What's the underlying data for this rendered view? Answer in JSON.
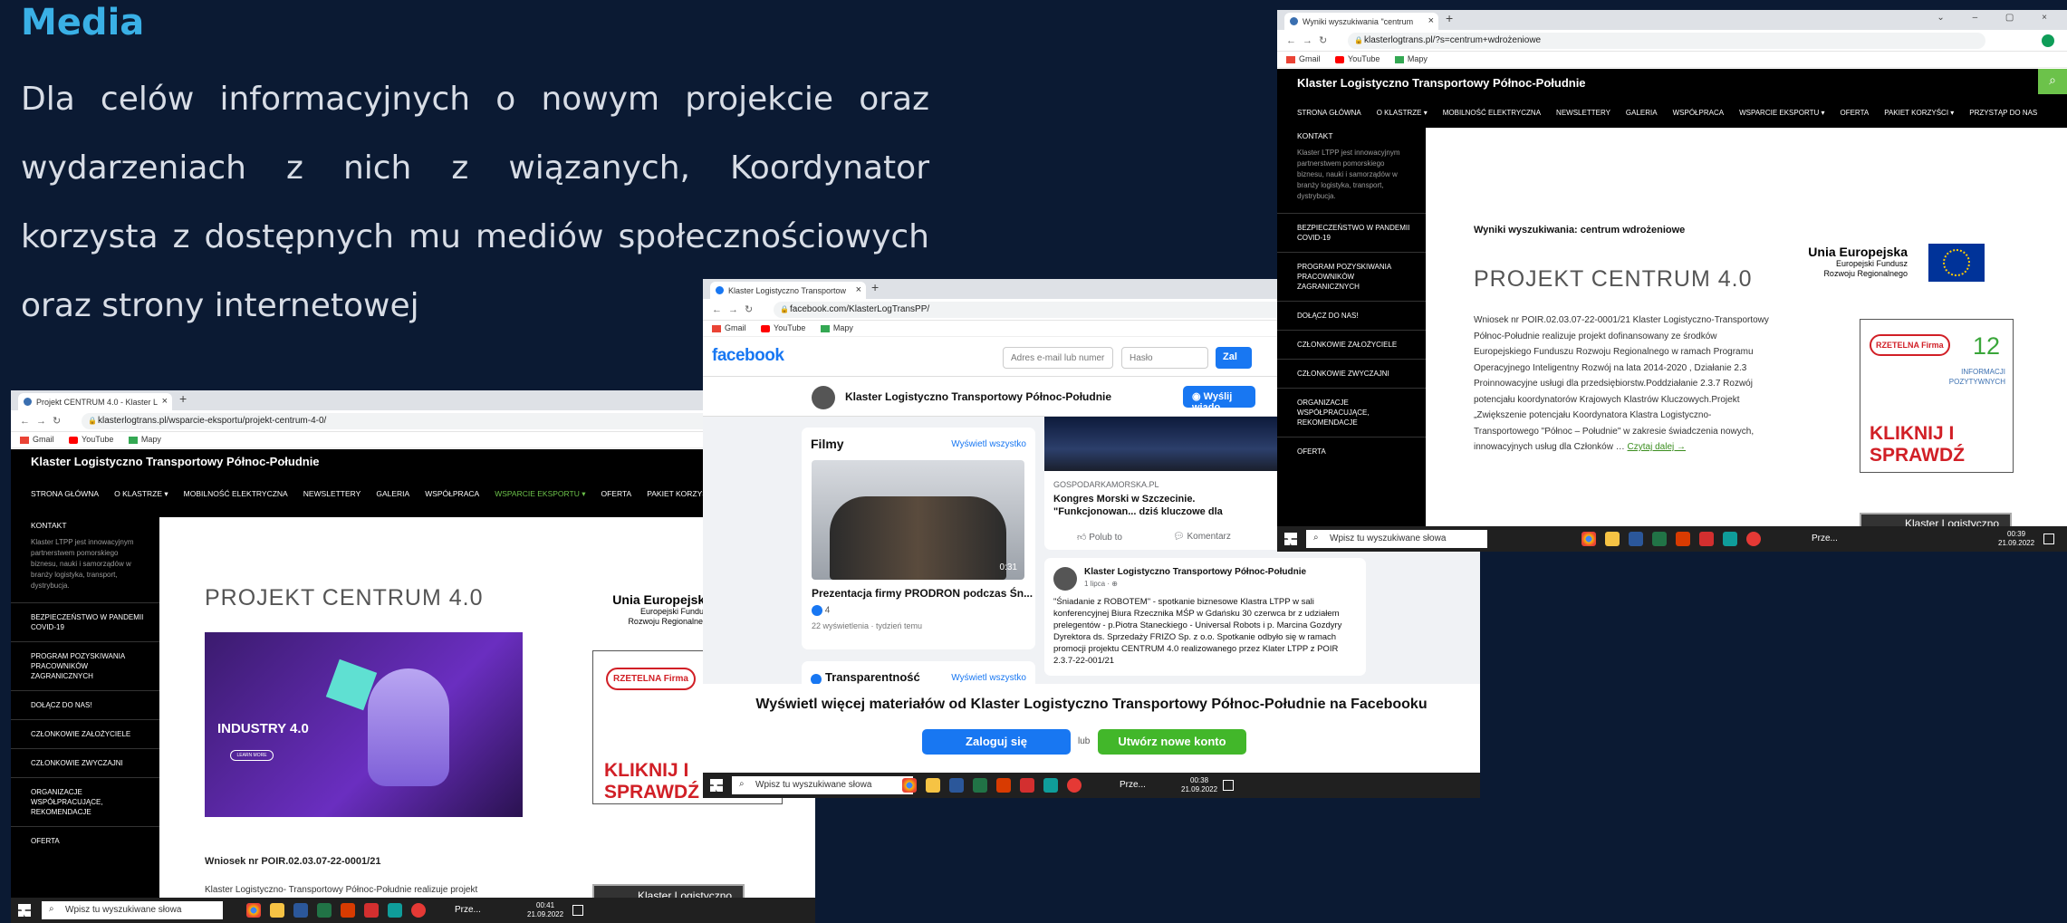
{
  "slide": {
    "title": "Media",
    "body": "Dla celów informacyjnych o nowym projekcie oraz wydarzeniach z nich z wiązanych, Koordynator korzysta z dostępnych mu mediów społecznościowych oraz strony internetowej"
  },
  "colors": {
    "slide_bg": "#0b1a33",
    "title": "#3ab0e6",
    "fb_blue": "#1877f2",
    "fb_green": "#42b72a",
    "rzetelna_red": "#d11f26",
    "ue_blue": "#003399"
  },
  "bookmarks": [
    "Gmail",
    "YouTube",
    "Mapy"
  ],
  "taskbar": {
    "search_placeholder": "Wpisz tu wyszukiwane słowa",
    "weather": "Prze..."
  },
  "shot1": {
    "tab_title": "Projekt CENTRUM 4.0 - Klaster L",
    "url": "klasterlogtrans.pl/wsparcie-eksportu/projekt-centrum-4-0/",
    "site_name": "Klaster Logistyczno Transportowy Północ-Południe",
    "menu": [
      "STRONA GŁÓWNA",
      "O KLASTRZE ▾",
      "MOBILNOŚĆ ELEKTRYCZNA",
      "NEWSLETTERY",
      "GALERIA",
      "WSPÓŁPRACA",
      "WSPARCIE EKSPORTU ▾",
      "OFERTA",
      "PAKIET KORZYŚCI ▾"
    ],
    "kontakt": "KONTAKT",
    "sidebar_desc": "Klaster LTPP jest innowacyjnym partnerstwem pomorskiego biznesu, nauki i samorządów w branży logistyka, transport, dystrybucja.",
    "sidebar_items": [
      "BEZPIECZEŃSTWO W PANDEMII COVID-19",
      "PROGRAM POZYSKIWANIA PRACOWNIKÓW ZAGRANICZNYCH",
      "DOŁĄCZ DO NAS!",
      "CZŁONKOWIE ZAŁOŻYCIELE",
      "CZŁONKOWIE ZWYCZAJNI",
      "ORGANIZACJE WSPÓŁPRACUJĄCE, REKOMENDACJE",
      "OFERTA"
    ],
    "heading": "PROJEKT CENTRUM 4.0",
    "banner_title": "INDUSTRY 4.0",
    "banner_btn": "LEARN MORE",
    "wniosek": "Wniosek nr POIR.02.03.07-22-0001/21",
    "para": "Klaster Logistyczno- Transportowy Północ-Południe realizuje projekt dofinansowany ze środków Europejskiego Funduszu",
    "ue_title": "Unia Europejska",
    "ue_sub": "Europejski Fundusz Rozwoju Regionalnego",
    "rzetelna": "RZETELNA Firma",
    "kliknij": "KLIKNIJ I SPRAWDŹ",
    "mini_card": "Klaster Logistyczno",
    "clock_time": "00:41",
    "clock_date": "21.09.2022"
  },
  "shot2": {
    "tab_title": "Klaster Logistyczno Transportow",
    "url": "facebook.com/KlasterLogTransPP/",
    "logo": "facebook",
    "email_placeholder": "Adres e-mail lub numer",
    "password_placeholder": "Hasło",
    "login_btn_partial": "Zal",
    "page_name": "Klaster Logistyczno Transportowy Północ-Południe",
    "send_btn": "Wyślij wiado",
    "filmy_title": "Filmy",
    "show_all": "Wyświetl wszystko",
    "video_duration": "0:31",
    "video_title": "Prezentacja firmy PRODRON podczas Śn...",
    "reactions": "4",
    "video_meta": "22 wyświetlenia · tydzień temu",
    "transparency": "Transparentność",
    "link_source": "GOSPODARKAMORSKA.PL",
    "link_title": "Kongres Morski w Szczecinie. \"Funkcjonowan... dziś kluczowe dla bezpieczeństwa kraju\" [WI...",
    "like": "Polub to",
    "comment": "Komentarz",
    "post_author": "Klaster Logistyczno Transportowy Północ-Południe",
    "post_date": "1 lipca · ⊕",
    "post_text": "\"Śniadanie z ROBOTEM\" - spotkanie biznesowe Klastra LTPP w sali konferencyjnej Biura Rzecznika MŚP w Gdańsku 30 czerwca br z udziałem prelegentów - p.Piotra Staneckiego - Universal Robots i p. Marcina Gozdyry Dyrektora ds. Sprzedaży FRIZO Sp. z o.o. Spotkanie odbyło się w ramach promocji projektu CENTRUM 4.0 realizowanego przez Klater LTPP z POIR 2.3.7-22-001/21",
    "cta_text": "Wyświetl więcej materiałów od Klaster Logistyczno Transportowy Północ-Południe na Facebooku",
    "cta_login": "Zaloguj się",
    "cta_or": "lub",
    "cta_new": "Utwórz nowe konto",
    "clock_time": "00:38",
    "clock_date": "21.09.2022"
  },
  "shot3": {
    "tab_title": "Wyniki wyszukiwania \"centrum",
    "url": "klasterlogtrans.pl/?s=centrum+wdrożeniowe",
    "site_name": "Klaster Logistyczno Transportowy Północ-Południe",
    "menu": [
      "STRONA GŁÓWNA",
      "O KLASTRZE ▾",
      "MOBILNOŚĆ ELEKTRYCZNA",
      "NEWSLETTERY",
      "GALERIA",
      "WSPÓŁPRACA",
      "WSPARCIE EKSPORTU ▾",
      "OFERTA",
      "PAKIET KORZYŚCI ▾",
      "PRZYSTĄP DO NAS"
    ],
    "kontakt": "KONTAKT",
    "sidebar_desc": "Klaster LTPP jest innowacyjnym partnerstwem pomorskiego biznesu, nauki i samorządów w branży logistyka, transport, dystrybucja.",
    "sidebar_items": [
      "BEZPIECZEŃSTWO W PANDEMII COVID-19",
      "PROGRAM POZYSKIWANIA PRACOWNIKÓW ZAGRANICZNYCH",
      "DOŁĄCZ DO NAS!",
      "CZŁONKOWIE ZAŁOŻYCIELE",
      "CZŁONKOWIE ZWYCZAJNI",
      "ORGANIZACJE WSPÓŁPRACUJĄCE, REKOMENDACJE",
      "OFERTA"
    ],
    "results_heading": "Wyniki wyszukiwania: centrum wdrożeniowe",
    "heading": "PROJEKT CENTRUM 4.0",
    "para": "Wniosek nr POIR.02.03.07-22-0001/21 Klaster Logistyczno-Transportowy Północ-Południe realizuje projekt dofinansowany ze środków Europejskiego Funduszu Rozwoju Regionalnego w ramach Programu Operacyjnego Inteligentny Rozwój na lata 2014-2020 , Działanie 2.3 Proinnowacyjne usługi dla przedsiębiorstw.Poddziałanie 2.3.7 Rozwój potencjału koordynatorów Krajowych Klastrów Kluczowych.Projekt „Zwiększenie potencjału Koordynatora Klastra Logistyczno-Transportowego \"Północ – Południe\" w zakresie świadczenia nowych, innowacyjnych usług dla Członków …",
    "read_more": "Czytaj dalej →",
    "ue_title": "Unia Europejska",
    "ue_sub": "Europejski Fundusz Rozwoju Regionalnego",
    "rzetelna": "RZETELNA Firma",
    "badge_number": "12",
    "badge_text": "INFORMACJI POZYTYWNYCH",
    "kliknij": "KLIKNIJ I SPRAWDŹ",
    "mini_card": "Klaster Logistyczno",
    "clock_time": "00:39",
    "clock_date": "21.09.2022"
  }
}
